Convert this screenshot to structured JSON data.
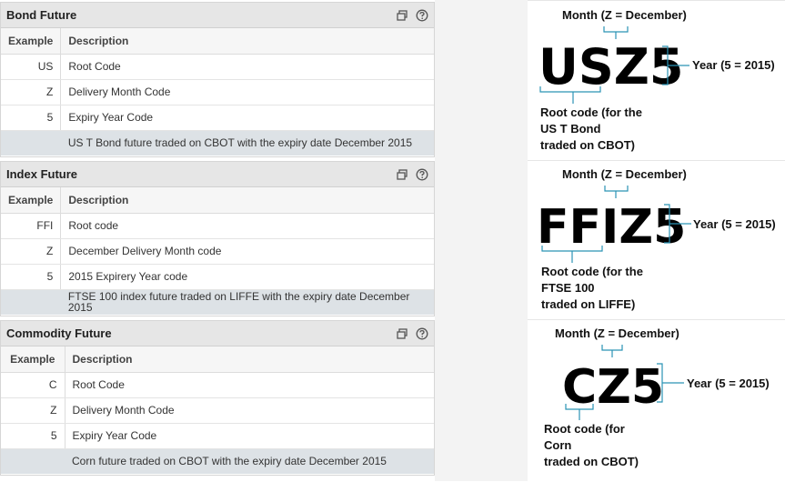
{
  "columns": {
    "example": "Example",
    "description": "Description"
  },
  "panels": [
    {
      "title": "Bond Future",
      "rows": [
        {
          "example": "US",
          "description": "Root Code"
        },
        {
          "example": "Z",
          "description": "Delivery Month Code"
        },
        {
          "example": "5",
          "description": "Expiry Year Code"
        }
      ],
      "summary": "US T Bond future traded on CBOT with the expiry date December 2015",
      "diagram": {
        "code": "USZ5",
        "month_label": "Month (Z = December)",
        "year_label": "Year (5 = 2015)",
        "root_lines": [
          "Root code (for the",
          "US T Bond",
          "traded on CBOT)"
        ]
      }
    },
    {
      "title": "Index Future",
      "rows": [
        {
          "example": "FFI",
          "description": "Root code"
        },
        {
          "example": "Z",
          "description": "December Delivery Month code"
        },
        {
          "example": "5",
          "description": "2015 Expirery Year code"
        }
      ],
      "summary": "FTSE 100 index future traded on LIFFE with the expiry date December 2015",
      "diagram": {
        "code": "FFIZ5",
        "month_label": "Month (Z = December)",
        "year_label": "Year (5 = 2015)",
        "root_lines": [
          "Root code (for the",
          "FTSE 100",
          "traded on LIFFE)"
        ]
      }
    },
    {
      "title": "Commodity Future",
      "rows": [
        {
          "example": "C",
          "description": "Root Code"
        },
        {
          "example": "Z",
          "description": "Delivery Month Code"
        },
        {
          "example": "5",
          "description": "Expiry Year Code"
        }
      ],
      "summary": "Corn future traded on CBOT with the expiry date December 2015",
      "diagram": {
        "code": "CZ5",
        "month_label": "Month (Z = December)",
        "year_label": "Year (5 = 2015)",
        "root_lines": [
          "Root code (for",
          "Corn",
          "traded on CBOT)"
        ]
      }
    }
  ],
  "icons": {
    "popout": "popout-icon",
    "help": "help-icon"
  },
  "colors": {
    "header_bg": "#e6e6e6",
    "summary_bg": "#dde2e6",
    "bracket": "#2a93b5"
  }
}
